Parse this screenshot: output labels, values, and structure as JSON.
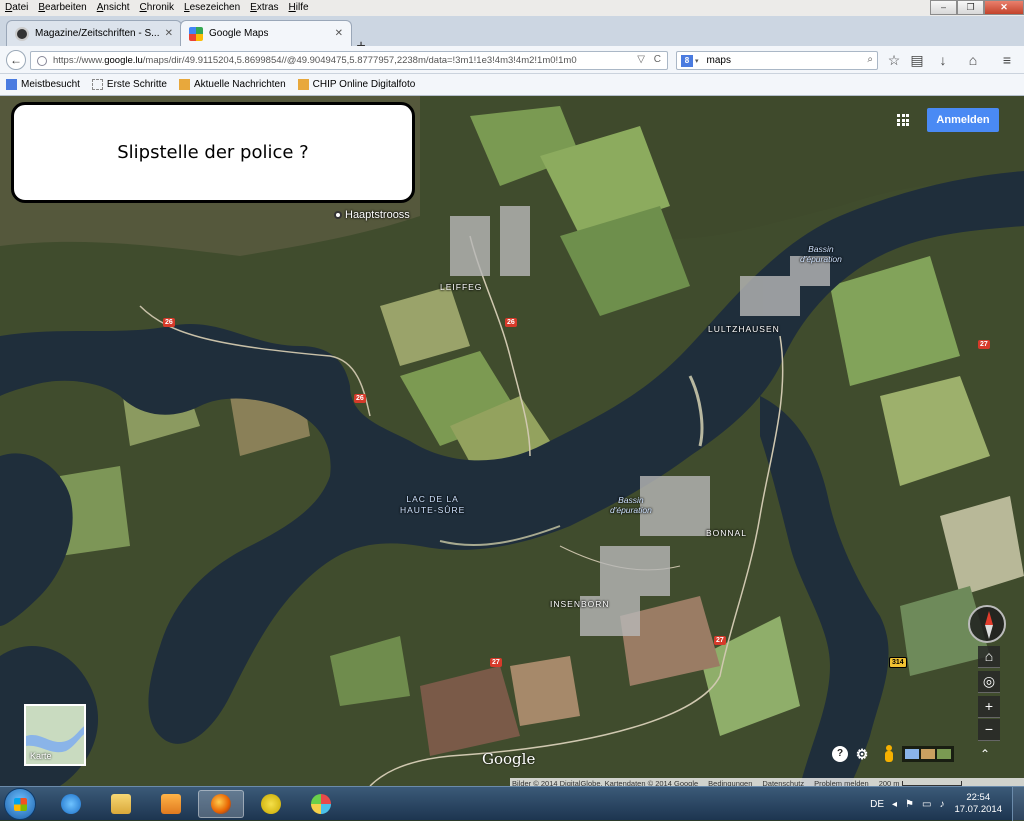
{
  "window": {
    "menu": [
      "Datei",
      "Bearbeiten",
      "Ansicht",
      "Chronik",
      "Lesezeichen",
      "Extras",
      "Hilfe"
    ],
    "controls": {
      "minimize": "–",
      "maximize": "❐",
      "close": "✕"
    }
  },
  "tabs": [
    {
      "label": "Magazine/Zeitschriften - S...",
      "close": "✕",
      "active": false
    },
    {
      "label": "Google Maps",
      "close": "✕",
      "active": true
    }
  ],
  "newtab_label": "+",
  "navbar": {
    "back": "←",
    "url_prefix": "https://www.",
    "url_host": "google.lu",
    "url_rest": "/maps/dir/49.9115204,5.8699854//@49.9049475,5.8777957,2238m/data=!3m1!1e3!4m3!4m2!1m0!1m0",
    "url_dropdown": "▽",
    "url_reload": "C",
    "search_engine": "8",
    "search_text": "maps",
    "search_icon": "⌕",
    "toolbar_icons": [
      "star-icon",
      "clipboard-icon",
      "download-icon",
      "home-icon",
      "menu-icon"
    ]
  },
  "bookmarks": [
    {
      "label": "Meistbesucht",
      "icon_color": "#4a7be0"
    },
    {
      "label": "Erste Schritte",
      "icon_color": "#ffffff"
    },
    {
      "label": "Aktuelle Nachrichten",
      "icon_color": "#e8a83c"
    },
    {
      "label": "CHIP Online Digitalfoto",
      "icon_color": "#e8a83c"
    }
  ],
  "map": {
    "callout": "Slipstelle der police ?",
    "place_marker": "Haaptstrooss",
    "signin": "Anmelden",
    "labels": {
      "village1": "LEIFFEG",
      "village2": "LULTZHAUSEN",
      "village3": "BONNAL",
      "village4": "INSENBORN",
      "lake": "LAC DE LA\nHAUTE-SÛRE",
      "basin1": "Bassin\nd'épuration",
      "basin2": "Bassin\nd'épuration"
    },
    "road_shields": [
      "26",
      "26",
      "26",
      "27",
      "27",
      "27",
      "314"
    ],
    "minimap_label": "Karte",
    "logo": "Google",
    "zoom_in": "+",
    "zoom_out": "−",
    "help": "?",
    "settings": "⚙",
    "expand": "⌃",
    "attribution": {
      "imagery": "Bilder © 2014 DigitalGlobe, Kartendaten © 2014 Google",
      "terms": "Bedingungen",
      "privacy": "Datenschutz",
      "report": "Problem melden",
      "scale": "200 m"
    }
  },
  "taskbar": {
    "apps": [
      "internet-explorer",
      "file-explorer",
      "media-player",
      "firefox",
      "s-app",
      "paint"
    ],
    "lang": "DE",
    "tray_symbols": [
      "◂",
      "⚑",
      "▭",
      "♪"
    ],
    "time": "22:54",
    "date": "17.07.2014"
  },
  "colors": {
    "water": "#1e2e3a",
    "forest": "#2f3d24",
    "field": "#6e8a4a",
    "accent": "#4a8af4"
  }
}
